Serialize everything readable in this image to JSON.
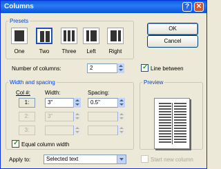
{
  "window": {
    "title": "Columns",
    "help": "?",
    "close": "✕"
  },
  "presets": {
    "title": "Presets",
    "items": [
      {
        "label": "One",
        "selected": false
      },
      {
        "label": "Two",
        "selected": true
      },
      {
        "label": "Three",
        "selected": false
      },
      {
        "label": "Left",
        "selected": false
      },
      {
        "label": "Right",
        "selected": false
      }
    ]
  },
  "buttons": {
    "ok": "OK",
    "cancel": "Cancel"
  },
  "num_columns": {
    "label": "Number of columns:",
    "value": "2"
  },
  "line_between": {
    "label": "Line between",
    "checked": true
  },
  "width_spacing": {
    "title": "Width and spacing",
    "col_header": "Col #:",
    "width_header": "Width:",
    "spacing_header": "Spacing:",
    "rows": [
      {
        "col": "1:",
        "width": "3\"",
        "spacing": "0.5\""
      },
      {
        "col": "2:",
        "width": "3\"",
        "spacing": ""
      },
      {
        "col": "3:",
        "width": "",
        "spacing": ""
      }
    ]
  },
  "equal_width": {
    "label": "Equal column width",
    "checked": true
  },
  "preview": {
    "title": "Preview"
  },
  "apply_to": {
    "label": "Apply to:",
    "value": "Selected text"
  },
  "start_new_column": {
    "label": "Start new column",
    "checked": false
  }
}
